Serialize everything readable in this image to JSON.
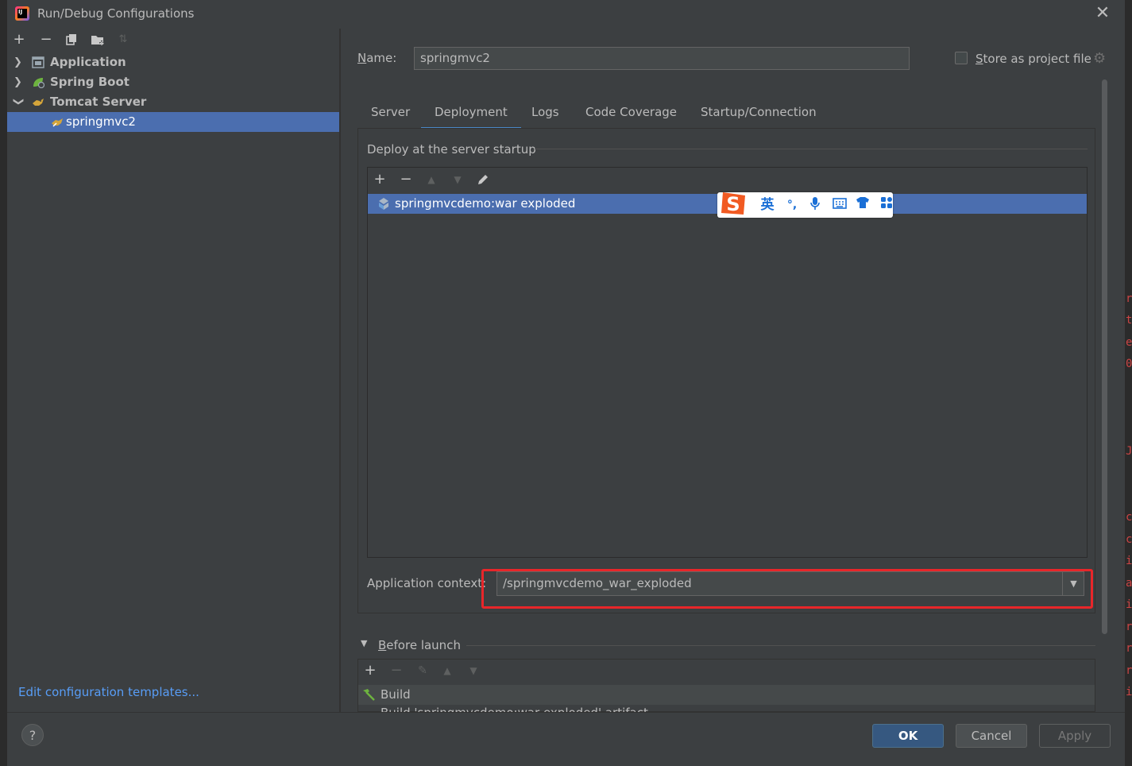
{
  "window": {
    "title": "Run/Debug Configurations",
    "close_icon": "close-icon"
  },
  "left_toolbar": {
    "add": "+",
    "remove": "−",
    "copy_icon": "copy-icon",
    "folder_icon": "new-folder-icon",
    "sort_icon": "sort-icon"
  },
  "tree": {
    "items": [
      {
        "label": "Application",
        "expanded": false,
        "icon": "application-icon"
      },
      {
        "label": "Spring Boot",
        "expanded": false,
        "icon": "spring-boot-icon"
      },
      {
        "label": "Tomcat Server",
        "expanded": true,
        "icon": "tomcat-icon"
      },
      {
        "label": "springmvc2",
        "selected": true,
        "icon": "tomcat-config-icon"
      }
    ]
  },
  "left_footer": {
    "templates_link": "Edit configuration templates...",
    "help": "?"
  },
  "form": {
    "name_label_prefix": "N",
    "name_label_rest": "ame:",
    "name_value": "springmvc2",
    "store_label_prefix": "S",
    "store_label_rest": "tore as project file",
    "store_checked": false
  },
  "tabs": {
    "items": [
      "Server",
      "Deployment",
      "Logs",
      "Code Coverage",
      "Startup/Connection"
    ],
    "active": "Deployment"
  },
  "deployment": {
    "section_title": "Deploy at the server startup",
    "toolbar": {
      "add": "+",
      "remove": "−",
      "edit_icon": "pencil-icon"
    },
    "artifacts": [
      "springmvcdemo:war exploded"
    ],
    "context_label": "Application context:",
    "context_value": "/springmvcdemo_war_exploded"
  },
  "ime": {
    "mode": "英",
    "punct": "°,",
    "icons": [
      "sogou-logo-icon",
      "microphone-icon",
      "keyboard-icon",
      "skin-shirt-icon",
      "toolbox-icon"
    ]
  },
  "before_launch": {
    "title_prefix": "B",
    "title_rest": "efore launch",
    "toolbar": {
      "add": "+",
      "remove": "−"
    },
    "items": [
      "Build"
    ],
    "partial_text": "Build 'springmvcdemo:war exploded' artifact"
  },
  "buttons": {
    "ok": "OK",
    "cancel": "Cancel",
    "apply": "Apply"
  },
  "colors": {
    "selection": "#4b6eaf",
    "highlight_border": "#e8262a",
    "link": "#589df6",
    "tab_underline": "#4a88c7"
  }
}
